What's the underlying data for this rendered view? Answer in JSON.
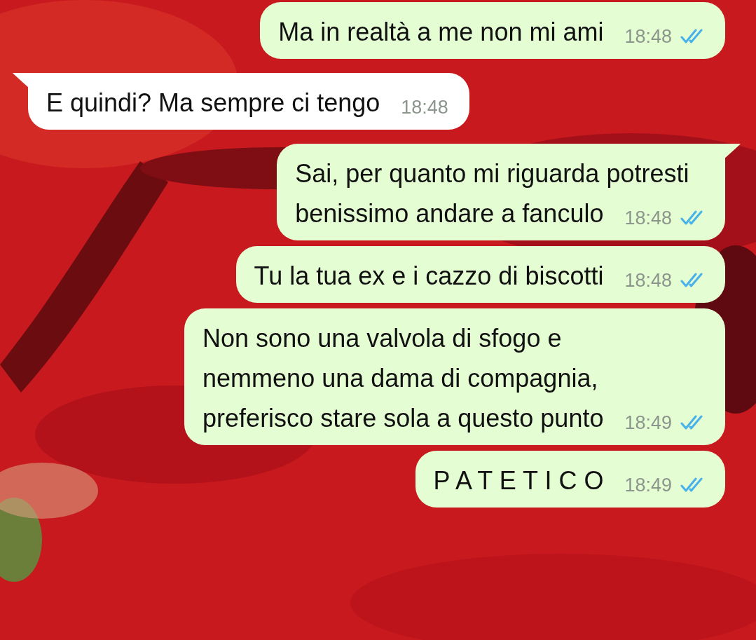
{
  "messages": [
    {
      "kind": "outgoing",
      "tail": false,
      "lines": [
        "Ma in realtà a me non mi ami"
      ],
      "time": "18:48",
      "read": true
    },
    {
      "kind": "incoming",
      "tail": true,
      "lines": [
        "E quindi? Ma sempre ci tengo"
      ],
      "time": "18:48"
    },
    {
      "kind": "outgoing",
      "tail": true,
      "lines": [
        "Sai, per quanto mi riguarda potresti",
        "benissimo andare a fanculo"
      ],
      "time": "18:48",
      "read": true
    },
    {
      "kind": "outgoing",
      "tail": false,
      "lines": [
        "Tu la tua ex e i cazzo di biscotti"
      ],
      "time": "18:48",
      "read": true
    },
    {
      "kind": "outgoing",
      "tail": false,
      "lines": [
        "Non sono una valvola di sfogo e",
        "nemmeno una dama di compagnia,",
        "preferisco stare sola a questo punto"
      ],
      "time": "18:49",
      "read": true
    },
    {
      "kind": "outgoing",
      "tail": false,
      "lines": [
        "P A T E T I C O"
      ],
      "time": "18:49",
      "read": true
    }
  ]
}
